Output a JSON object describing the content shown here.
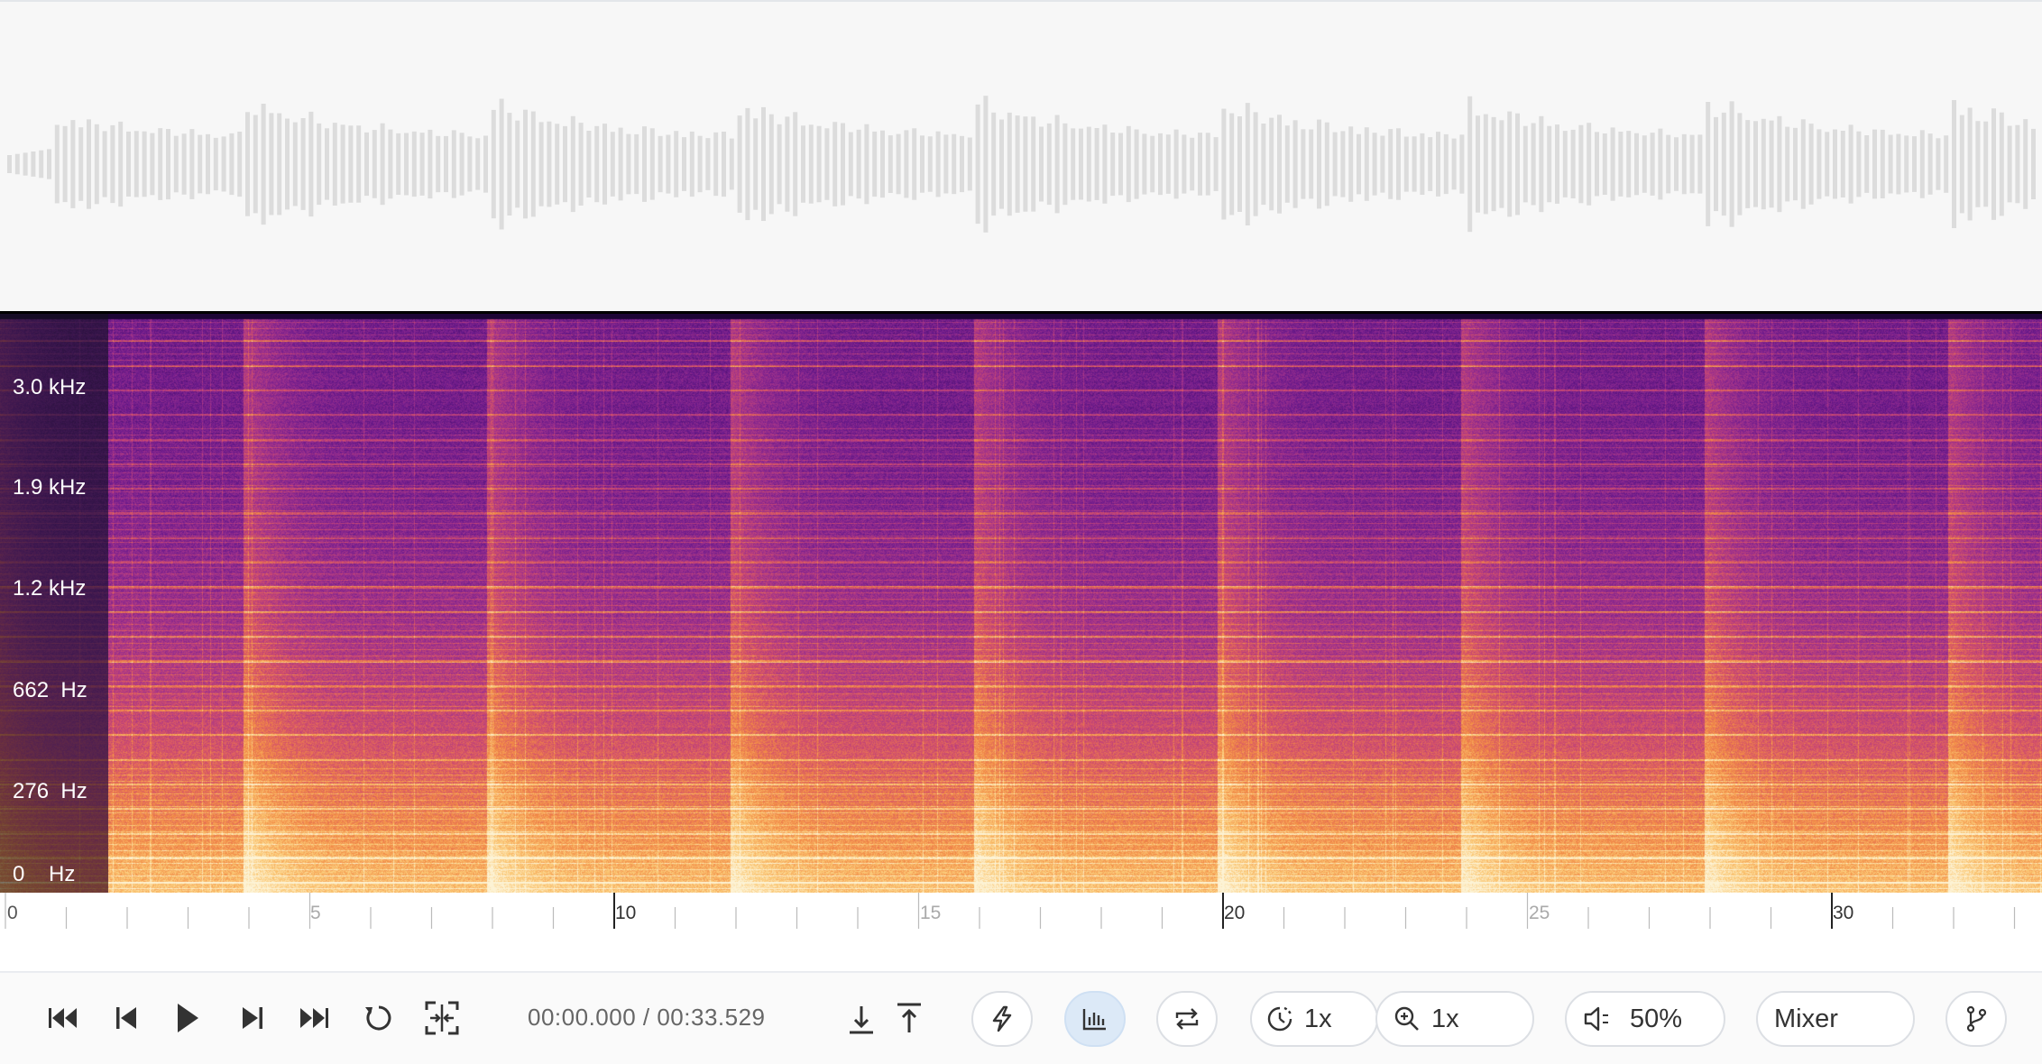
{
  "spectrogram": {
    "freq_labels": [
      "3.0 kHz",
      "1.9 kHz",
      "1.2 kHz",
      "662  Hz",
      "276  Hz",
      "0    Hz"
    ],
    "colormap": [
      "#0d0221",
      "#3b0a5a",
      "#6a1a8c",
      "#a0328c",
      "#d4506a",
      "#f28a46",
      "#fbc874",
      "#fdf3d6"
    ]
  },
  "timeline": {
    "major_labels": [
      "10",
      "20",
      "30"
    ],
    "minor_labels": [
      "0",
      "5",
      "15",
      "25"
    ]
  },
  "transport": {
    "time_display": "00:00.000 / 00:33.529",
    "icons": [
      "skip-to-start-icon",
      "previous-icon",
      "play-icon",
      "next-icon",
      "skip-to-end-icon",
      "loop-icon",
      "fit-icon"
    ]
  },
  "toolbar": {
    "speed_label": "1x",
    "zoom_label": "1x",
    "volume_label": "50%",
    "mixer_label": "Mixer"
  },
  "colors": {
    "waveform_bar": "#dcdcdc",
    "accent_active": "#dce9f7"
  }
}
